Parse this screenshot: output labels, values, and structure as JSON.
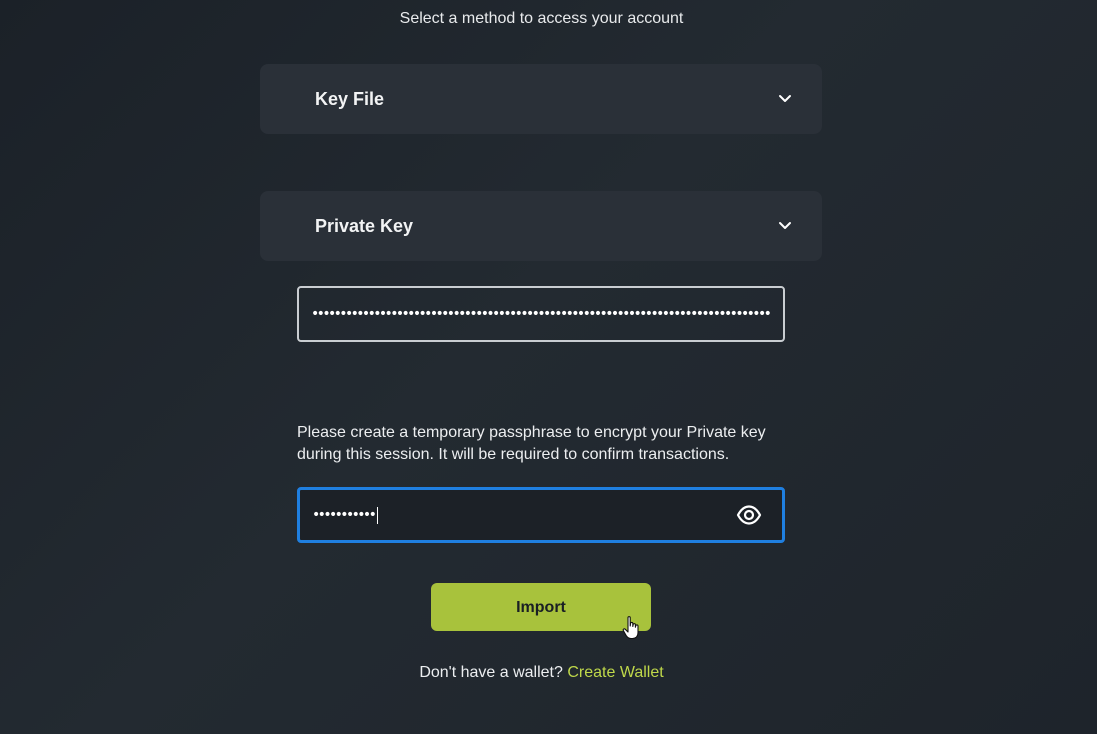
{
  "header": {
    "subtitle": "Select a method to access your account"
  },
  "methods": [
    {
      "label": "Key File",
      "icon": "chevron-down-icon"
    },
    {
      "label": "Private Key",
      "icon": "chevron-down-icon"
    }
  ],
  "private_key": {
    "value": "••••••••••••••••••••••••••••••••••••••••••••••••••••••••••••••••••••••••••••••••••••••••••••••"
  },
  "passphrase": {
    "instructions": "Please create a temporary passphrase to encrypt your Private key during this session. It will be required to confirm transactions.",
    "value": "•••••••••••",
    "toggle_icon": "eye-icon"
  },
  "actions": {
    "import_label": "Import"
  },
  "footer": {
    "prompt": "Don't have a wallet?",
    "link": "Create Wallet"
  },
  "colors": {
    "accent_green": "#a8c23c",
    "link_green": "#bfd84a",
    "focus_blue": "#1f7fe0",
    "panel": "#2a3038"
  }
}
